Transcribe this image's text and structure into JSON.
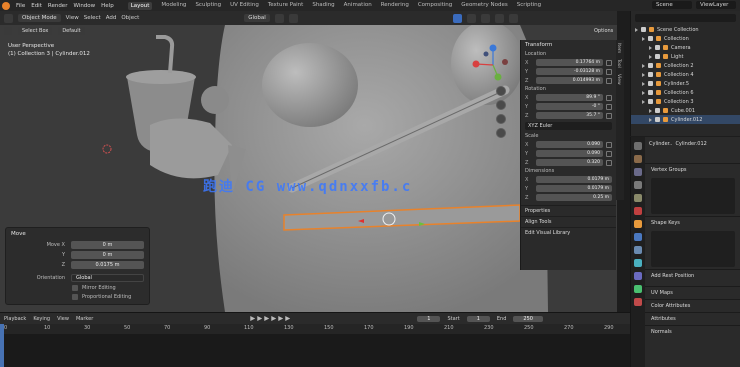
{
  "menubar": {
    "items": [
      "File",
      "Edit",
      "Render",
      "Window",
      "Help"
    ],
    "workspaces": [
      "Layout",
      "Modeling",
      "Sculpting",
      "UV Editing",
      "Texture Paint",
      "Shading",
      "Animation",
      "Rendering",
      "Compositing",
      "Geometry Nodes",
      "Scripting"
    ],
    "active_workspace": "Layout",
    "scene": "Scene",
    "view_layer": "ViewLayer"
  },
  "viewport_header": {
    "mode": "Object Mode",
    "menus": [
      "View",
      "Select",
      "Add",
      "Object"
    ],
    "orientation": "Global",
    "select_mode": "Default",
    "drag": "Select Box",
    "options": "Options"
  },
  "viewport_info": {
    "line1": "User Perspective",
    "line2": "(1) Collection 3 | Cylinder.012"
  },
  "watermark": "跑迪 CG  www.qdnxxfb.c",
  "n_panel": {
    "transform_label": "Transform",
    "location_label": "Location",
    "location": [
      {
        "axis": "X",
        "value": "0.17764 m"
      },
      {
        "axis": "Y",
        "value": "-0.03128 m"
      },
      {
        "axis": "Z",
        "value": "0.014993 m"
      }
    ],
    "rotation_label": "Rotation",
    "rotation": [
      {
        "axis": "X",
        "value": "89.9 °"
      },
      {
        "axis": "Y",
        "value": "-0 °"
      },
      {
        "axis": "Z",
        "value": "35.7 °"
      }
    ],
    "rotation_mode": "XYZ Euler",
    "scale_label": "Scale",
    "scale": [
      {
        "axis": "X",
        "value": "0.090"
      },
      {
        "axis": "Y",
        "value": "0.090"
      },
      {
        "axis": "Z",
        "value": "0.320"
      }
    ],
    "dimensions_label": "Dimensions",
    "dimensions": [
      {
        "axis": "X",
        "value": "0.0179 m"
      },
      {
        "axis": "Y",
        "value": "0.0179 m"
      },
      {
        "axis": "Z",
        "value": "0.25 m"
      }
    ],
    "collapsed": [
      "Properties",
      "Align Tools",
      "Edit Visual Library"
    ],
    "tabs": [
      "Item",
      "Tool",
      "View"
    ]
  },
  "operator_panel": {
    "title": "Move",
    "move_x_label": "Move X",
    "move_x": "0 m",
    "y_label": "Y",
    "y": "0 m",
    "z_label": "Z",
    "z": "0.0175 m",
    "orientation_label": "Orientation",
    "orientation": "Global",
    "checks": [
      "Mirror Editing",
      "Proportional Editing"
    ]
  },
  "outliner": {
    "items": [
      {
        "label": "Scene Collection",
        "indent": 0
      },
      {
        "label": "Collection",
        "indent": 1
      },
      {
        "label": "Camera",
        "indent": 2
      },
      {
        "label": "Light",
        "indent": 2
      },
      {
        "label": "Collection 2",
        "indent": 1
      },
      {
        "label": "Collection 4",
        "indent": 1
      },
      {
        "label": "Cylinder.5",
        "indent": 1
      },
      {
        "label": "Collection 6",
        "indent": 1
      },
      {
        "label": "Collection 3",
        "indent": 1
      },
      {
        "label": "Cube.001",
        "indent": 2
      },
      {
        "label": "Cylinder.012",
        "indent": 2
      }
    ]
  },
  "properties": {
    "object_name": "Cylinder.012",
    "breadcrumb": "Cylinder..",
    "sections": [
      "Vertex Groups",
      "Shape Keys",
      "Add Rest Position",
      "UV Maps",
      "Color Attributes",
      "Attributes",
      "Normals"
    ]
  },
  "timeline": {
    "menus": [
      "Playback",
      "Keying",
      "View",
      "Marker"
    ],
    "current_frame": "1",
    "start_label": "Start",
    "start": "1",
    "end_label": "End",
    "end": "250",
    "ruler": [
      "0",
      "10",
      "30",
      "50",
      "70",
      "90",
      "110",
      "130",
      "150",
      "170",
      "190",
      "210",
      "230",
      "250",
      "270",
      "290"
    ]
  },
  "colors": {
    "accent": "#4772b3",
    "selection_outline": "#e8822b",
    "watermark": "#3b78ff"
  }
}
